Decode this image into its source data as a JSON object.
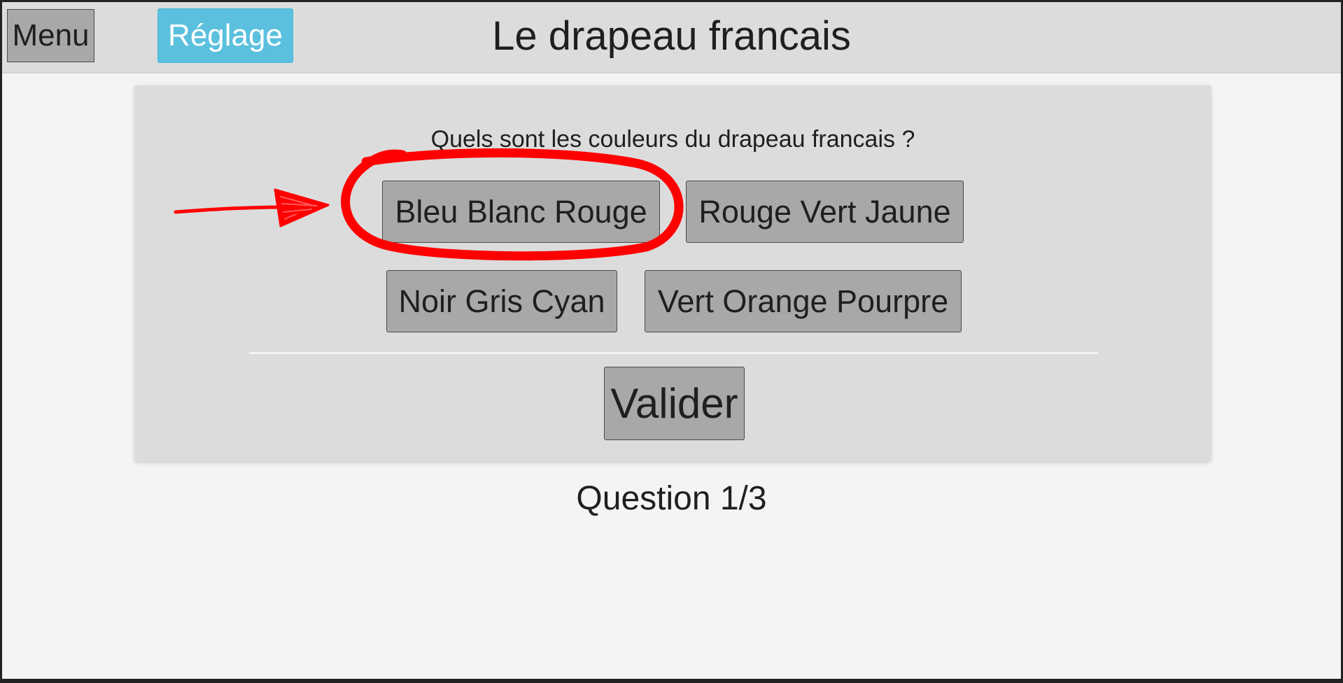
{
  "header": {
    "menu_label": "Menu",
    "settings_label": "Réglage",
    "title": "Le drapeau francais"
  },
  "quiz": {
    "question": "Quels sont les couleurs du drapeau francais ?",
    "answers": [
      {
        "label": "Bleu Blanc Rouge",
        "highlighted": true
      },
      {
        "label": "Rouge Vert Jaune"
      },
      {
        "label": "Noir Gris Cyan"
      },
      {
        "label": "Vert Orange Pourpre"
      }
    ],
    "submit_label": "Valider",
    "progress": "Question 1/3"
  },
  "colors": {
    "accent": "#5bc0de",
    "annotation": "#ff0000",
    "button": "#a8a8a8",
    "card": "#dcdcdc",
    "background": "#f4f4f4"
  }
}
